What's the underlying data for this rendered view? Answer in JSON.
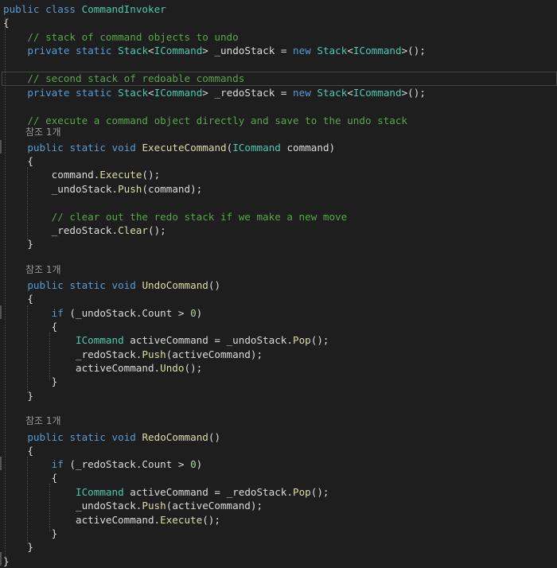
{
  "editor": {
    "language": "C#",
    "theme_colors": {
      "background": "#1e1e1e",
      "keyword": "#569cd6",
      "type": "#4ec9b0",
      "comment": "#57a64a",
      "method": "#dcdcaa",
      "number": "#b5cea8",
      "text": "#dcdcdc",
      "reference_hint": "#999999"
    },
    "reference_hint": "참조 1개",
    "lines": [
      {
        "tokens": [
          [
            "kw",
            "public"
          ],
          [
            "tx",
            " "
          ],
          [
            "kw",
            "class"
          ],
          [
            "tx",
            " "
          ],
          [
            "ty",
            "CommandInvoker"
          ]
        ]
      },
      {
        "tokens": [
          [
            "tx",
            "{"
          ]
        ]
      },
      {
        "tokens": [
          [
            "tx",
            "    "
          ],
          [
            "cm",
            "// stack of command objects to undo"
          ]
        ]
      },
      {
        "tokens": [
          [
            "tx",
            "    "
          ],
          [
            "kw",
            "private"
          ],
          [
            "tx",
            " "
          ],
          [
            "kw",
            "static"
          ],
          [
            "tx",
            " "
          ],
          [
            "ty",
            "Stack"
          ],
          [
            "tx",
            "<"
          ],
          [
            "ty",
            "ICommand"
          ],
          [
            "tx",
            "> "
          ],
          [
            "tx",
            "_undoStack"
          ],
          [
            "tx",
            " = "
          ],
          [
            "kw",
            "new"
          ],
          [
            "tx",
            " "
          ],
          [
            "ty",
            "Stack"
          ],
          [
            "tx",
            "<"
          ],
          [
            "ty",
            "ICommand"
          ],
          [
            "tx",
            ">();"
          ]
        ]
      },
      {
        "tokens": [
          [
            "tx",
            ""
          ]
        ]
      },
      {
        "tokens": [
          [
            "tx",
            "    "
          ],
          [
            "cm",
            "// second stack of redoable commands"
          ]
        ]
      },
      {
        "tokens": [
          [
            "tx",
            "    "
          ],
          [
            "kw",
            "private"
          ],
          [
            "tx",
            " "
          ],
          [
            "kw",
            "static"
          ],
          [
            "tx",
            " "
          ],
          [
            "ty",
            "Stack"
          ],
          [
            "tx",
            "<"
          ],
          [
            "ty",
            "ICommand"
          ],
          [
            "tx",
            "> "
          ],
          [
            "tx",
            "_redoStack"
          ],
          [
            "tx",
            " = "
          ],
          [
            "kw",
            "new"
          ],
          [
            "tx",
            " "
          ],
          [
            "ty",
            "Stack"
          ],
          [
            "tx",
            "<"
          ],
          [
            "ty",
            "ICommand"
          ],
          [
            "tx",
            ">();"
          ]
        ]
      },
      {
        "tokens": [
          [
            "tx",
            ""
          ]
        ]
      },
      {
        "tokens": [
          [
            "tx",
            "    "
          ],
          [
            "cm",
            "// execute a command object directly and save to the undo stack"
          ]
        ]
      },
      {
        "tokens": [
          [
            "tx",
            "    "
          ],
          [
            "kw",
            "public"
          ],
          [
            "tx",
            " "
          ],
          [
            "kw",
            "static"
          ],
          [
            "tx",
            " "
          ],
          [
            "kw",
            "void"
          ],
          [
            "tx",
            " "
          ],
          [
            "fn",
            "ExecuteCommand"
          ],
          [
            "tx",
            "("
          ],
          [
            "ty",
            "ICommand"
          ],
          [
            "tx",
            " command)"
          ]
        ]
      },
      {
        "tokens": [
          [
            "tx",
            "    {"
          ]
        ]
      },
      {
        "tokens": [
          [
            "tx",
            "        command."
          ],
          [
            "fn",
            "Execute"
          ],
          [
            "tx",
            "();"
          ]
        ]
      },
      {
        "tokens": [
          [
            "tx",
            "        _undoStack."
          ],
          [
            "fn",
            "Push"
          ],
          [
            "tx",
            "(command);"
          ]
        ]
      },
      {
        "tokens": [
          [
            "tx",
            ""
          ]
        ]
      },
      {
        "tokens": [
          [
            "tx",
            "        "
          ],
          [
            "cm",
            "// clear out the redo stack if we make a new move"
          ]
        ]
      },
      {
        "tokens": [
          [
            "tx",
            "        _redoStack."
          ],
          [
            "fn",
            "Clear"
          ],
          [
            "tx",
            "();"
          ]
        ]
      },
      {
        "tokens": [
          [
            "tx",
            "    }"
          ]
        ]
      },
      {
        "tokens": [
          [
            "tx",
            ""
          ]
        ]
      },
      {
        "tokens": [
          [
            "tx",
            "    "
          ],
          [
            "kw",
            "public"
          ],
          [
            "tx",
            " "
          ],
          [
            "kw",
            "static"
          ],
          [
            "tx",
            " "
          ],
          [
            "kw",
            "void"
          ],
          [
            "tx",
            " "
          ],
          [
            "fn",
            "UndoCommand"
          ],
          [
            "tx",
            "()"
          ]
        ]
      },
      {
        "tokens": [
          [
            "tx",
            "    {"
          ]
        ]
      },
      {
        "tokens": [
          [
            "tx",
            "        "
          ],
          [
            "kw",
            "if"
          ],
          [
            "tx",
            " (_undoStack.Count > "
          ],
          [
            "nm",
            "0"
          ],
          [
            "tx",
            ")"
          ]
        ]
      },
      {
        "tokens": [
          [
            "tx",
            "        {"
          ]
        ]
      },
      {
        "tokens": [
          [
            "tx",
            "            "
          ],
          [
            "ty",
            "ICommand"
          ],
          [
            "tx",
            " activeCommand = _undoStack."
          ],
          [
            "fn",
            "Pop"
          ],
          [
            "tx",
            "();"
          ]
        ]
      },
      {
        "tokens": [
          [
            "tx",
            "            _redoStack."
          ],
          [
            "fn",
            "Push"
          ],
          [
            "tx",
            "(activeCommand);"
          ]
        ]
      },
      {
        "tokens": [
          [
            "tx",
            "            activeCommand."
          ],
          [
            "fn",
            "Undo"
          ],
          [
            "tx",
            "();"
          ]
        ]
      },
      {
        "tokens": [
          [
            "tx",
            "        }"
          ]
        ]
      },
      {
        "tokens": [
          [
            "tx",
            "    }"
          ]
        ]
      },
      {
        "tokens": [
          [
            "tx",
            ""
          ]
        ]
      },
      {
        "tokens": [
          [
            "tx",
            "    "
          ],
          [
            "kw",
            "public"
          ],
          [
            "tx",
            " "
          ],
          [
            "kw",
            "static"
          ],
          [
            "tx",
            " "
          ],
          [
            "kw",
            "void"
          ],
          [
            "tx",
            " "
          ],
          [
            "fn",
            "RedoCommand"
          ],
          [
            "tx",
            "()"
          ]
        ]
      },
      {
        "tokens": [
          [
            "tx",
            "    {"
          ]
        ]
      },
      {
        "tokens": [
          [
            "tx",
            "        "
          ],
          [
            "kw",
            "if"
          ],
          [
            "tx",
            " (_redoStack.Count > "
          ],
          [
            "nm",
            "0"
          ],
          [
            "tx",
            ")"
          ]
        ]
      },
      {
        "tokens": [
          [
            "tx",
            "        {"
          ]
        ]
      },
      {
        "tokens": [
          [
            "tx",
            "            "
          ],
          [
            "ty",
            "ICommand"
          ],
          [
            "tx",
            " activeCommand = _redoStack."
          ],
          [
            "fn",
            "Pop"
          ],
          [
            "tx",
            "();"
          ]
        ]
      },
      {
        "tokens": [
          [
            "tx",
            "            _undoStack."
          ],
          [
            "fn",
            "Push"
          ],
          [
            "tx",
            "(activeCommand);"
          ]
        ]
      },
      {
        "tokens": [
          [
            "tx",
            "            activeCommand."
          ],
          [
            "fn",
            "Execute"
          ],
          [
            "tx",
            "();"
          ]
        ]
      },
      {
        "tokens": [
          [
            "tx",
            "        }"
          ]
        ]
      },
      {
        "tokens": [
          [
            "tx",
            "    }"
          ]
        ]
      },
      {
        "tokens": [
          [
            "tx",
            "}"
          ]
        ]
      }
    ]
  }
}
